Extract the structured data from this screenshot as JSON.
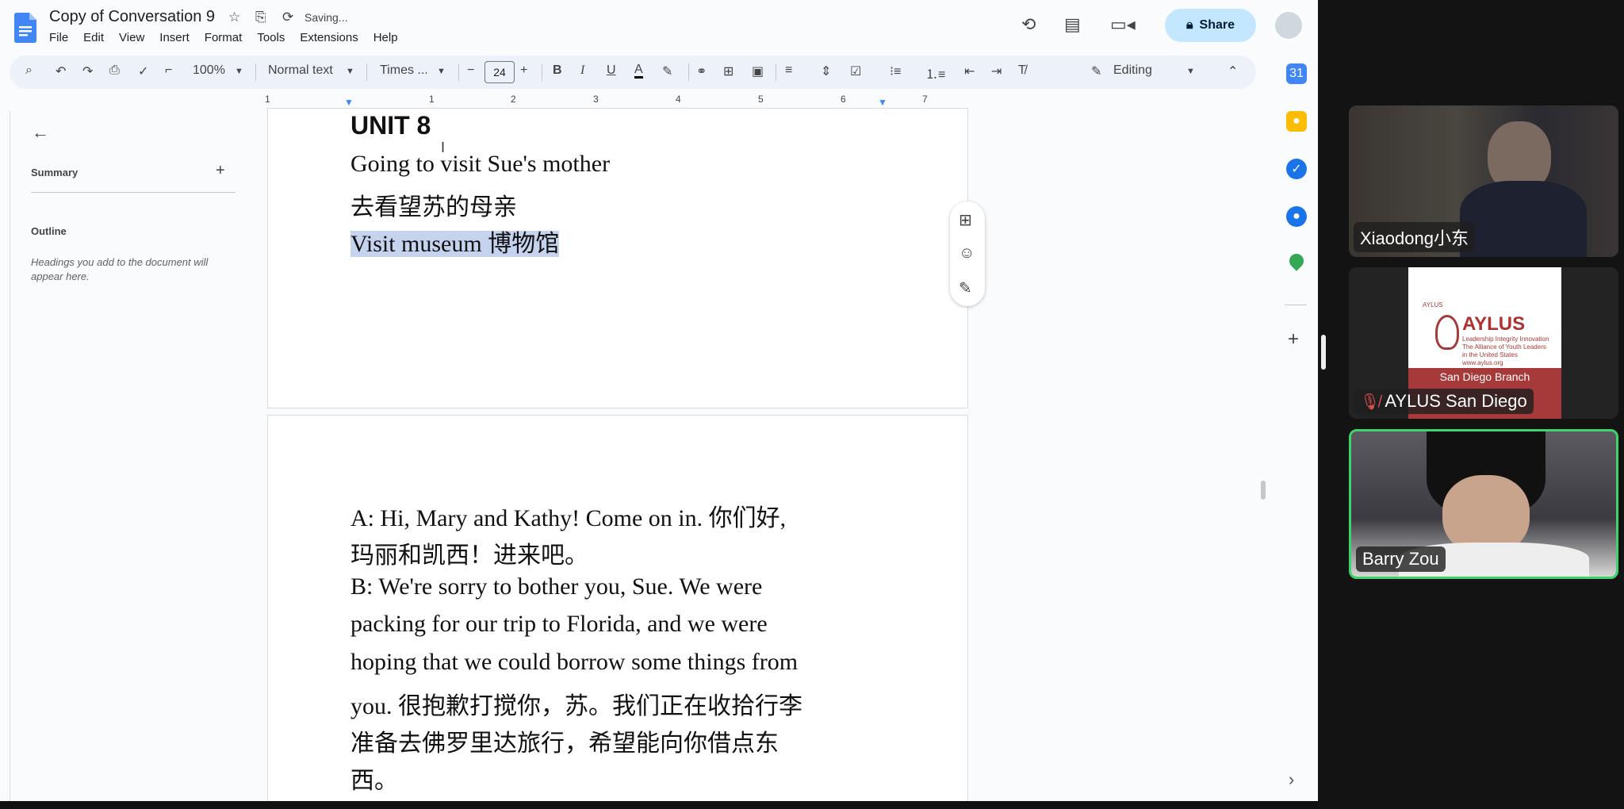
{
  "docs": {
    "title": "Copy of Conversation 9",
    "status": "Saving...",
    "menu": [
      "File",
      "Edit",
      "View",
      "Insert",
      "Format",
      "Tools",
      "Extensions",
      "Help"
    ],
    "share_label": "Share",
    "toolbar": {
      "zoom": "100%",
      "style": "Normal text",
      "font": "Times ...",
      "font_size": "24",
      "bold": "B",
      "italic": "I",
      "underline": "U",
      "text_color": "A",
      "mode": "Editing"
    },
    "ruler_numbers": [
      "1",
      "1",
      "2",
      "3",
      "4",
      "5",
      "6",
      "7"
    ],
    "side_panel": {
      "summary_label": "Summary",
      "outline_label": "Outline",
      "outline_hint": "Headings you add to the document will appear here."
    },
    "page1": {
      "heading": "UNIT 8",
      "line1": "Going to visit Sue's mother",
      "line2": "去看望苏的母亲",
      "line3": "Visit museum 博物馆"
    },
    "page2": {
      "lines": [
        "A: Hi, Mary and Kathy! Come on in. 你们好,",
        "玛丽和凯西！进来吧。",
        "B: We're sorry to bother you, Sue. We were",
        "packing for our trip to Florida, and we were",
        "hoping that we could borrow some things from",
        "you. 很抱歉打搅你，苏。我们正在收拾行李",
        "准备去佛罗里达旅行，希望能向你借点东",
        "西。"
      ]
    }
  },
  "meeting": {
    "participants": [
      {
        "name": "Xiaodong小东"
      },
      {
        "name": "AYLUS San Diego",
        "muted": true,
        "card": {
          "small": "AYLUS",
          "title": "AYLUS",
          "tagline": "Leadership Integrity Innovation The Alliance of Youth Leaders in the United States www.aylus.org",
          "branch": "San Diego Branch"
        }
      },
      {
        "name": "Barry Zou",
        "active": true
      }
    ]
  },
  "colors": {
    "accent": "#c2e7ff",
    "highlight": "#c6d3ee",
    "active_speaker": "#3dd46b",
    "aylus_red": "#a63a3a"
  }
}
